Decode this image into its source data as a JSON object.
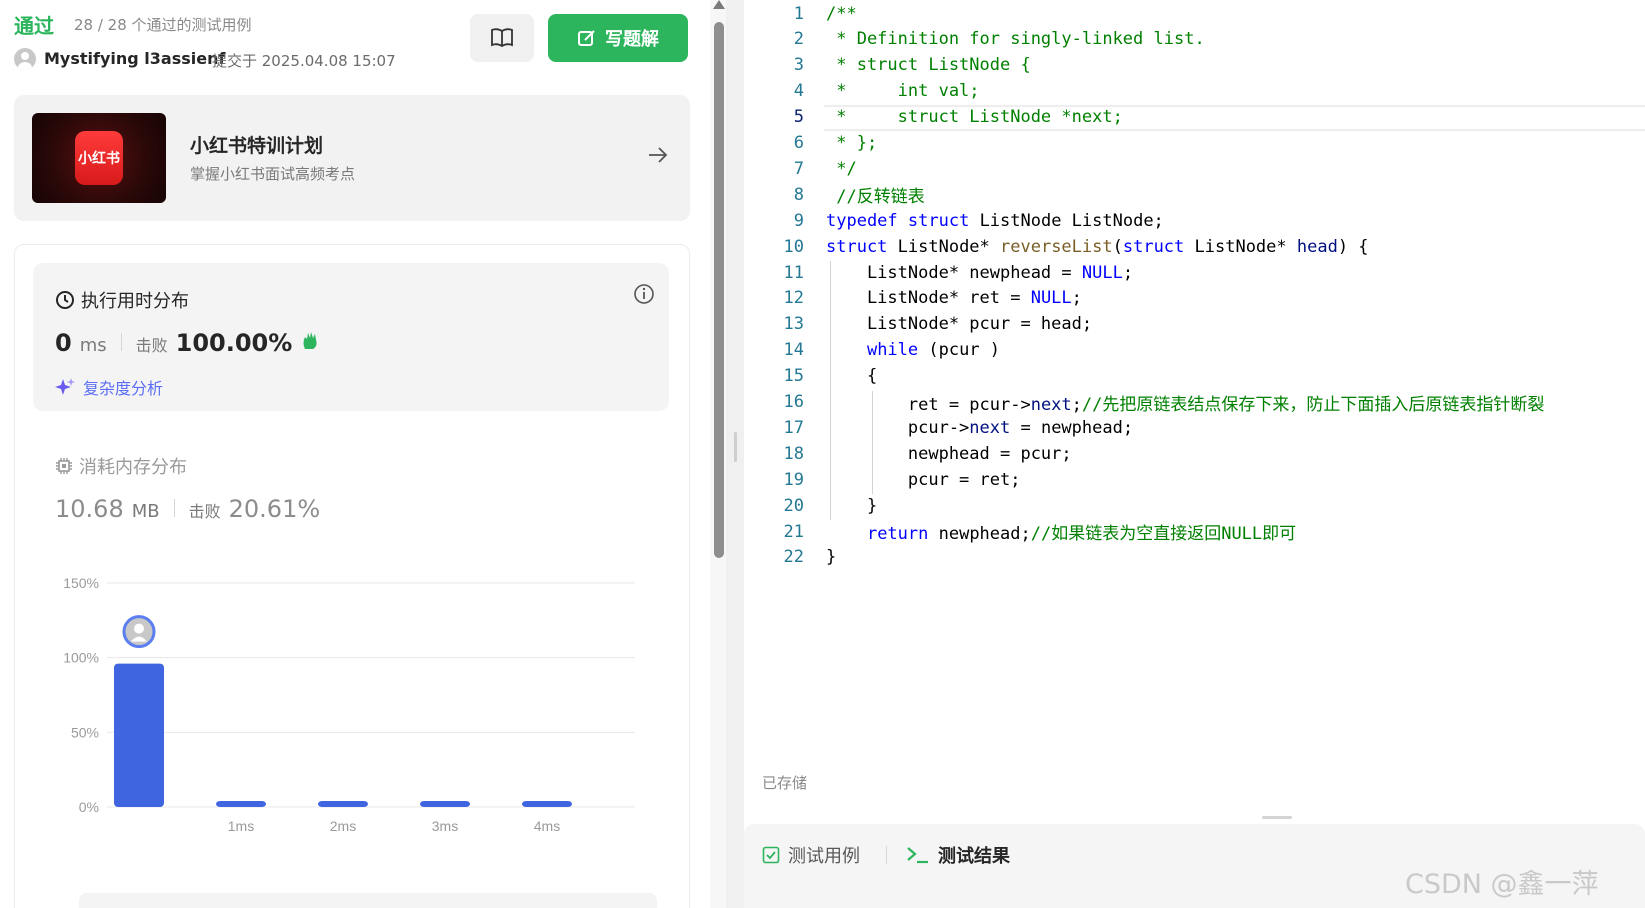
{
  "header": {
    "status": "通过",
    "cases": "28 / 28 个通过的测试用例",
    "user": "Mystifying l3assienf",
    "submitted": "提交于 2025.04.08 15:07",
    "write_label": "写题解"
  },
  "promo": {
    "logo_text": "小红书",
    "title": "小红书特训计划",
    "subtitle": "掌握小红书面试高频考点"
  },
  "runtime": {
    "title": "执行用时分布",
    "value": "0",
    "unit": "ms",
    "beat_label": "击败",
    "beat_value": "100.00%",
    "complexity_label": "复杂度分析"
  },
  "memory": {
    "title": "消耗内存分布",
    "value": "10.68",
    "unit": "MB",
    "beat_label": "击败",
    "beat_value": "20.61%"
  },
  "chart_data": {
    "type": "bar",
    "categories": [
      "0ms",
      "1ms",
      "2ms",
      "3ms",
      "4ms"
    ],
    "category_labels": [
      "",
      "1ms",
      "2ms",
      "3ms",
      "4ms"
    ],
    "values": [
      96,
      2,
      2,
      2,
      2
    ],
    "yticks": [
      "150%",
      "100%",
      "50%",
      "0%"
    ],
    "ylim": [
      0,
      150
    ],
    "bar_color": "#3f66e0",
    "highlight_index": 0
  },
  "code": [
    "/**",
    " * Definition for singly-linked list.",
    " * struct ListNode {",
    " *     int val;",
    " *     struct ListNode *next;",
    " * };",
    " */",
    " //反转链表",
    "typedef struct ListNode ListNode;",
    "struct ListNode* reverseList(struct ListNode* head) {",
    "    ListNode* newphead = NULL;",
    "    ListNode* ret = NULL;",
    "    ListNode* pcur = head;",
    "    while (pcur )",
    "    {",
    "        ret = pcur->next;//先把原链表结点保存下来，防止下面插入后原链表指针断裂",
    "        pcur->next = newphead;",
    "        newphead = pcur;",
    "        pcur = ret;",
    "    }",
    "    return newphead;//如果链表为空直接返回NULL即可",
    "}"
  ],
  "editor": {
    "saved_label": "已存储",
    "active_line": 5
  },
  "bottom_tabs": {
    "cases_label": "测试用例",
    "results_label": "测试结果"
  },
  "watermark": "CSDN @鑫一萍",
  "colors": {
    "accent_green": "#2db55d",
    "link_purple": "#5b6ef5",
    "bar_blue": "#3f66e0"
  }
}
